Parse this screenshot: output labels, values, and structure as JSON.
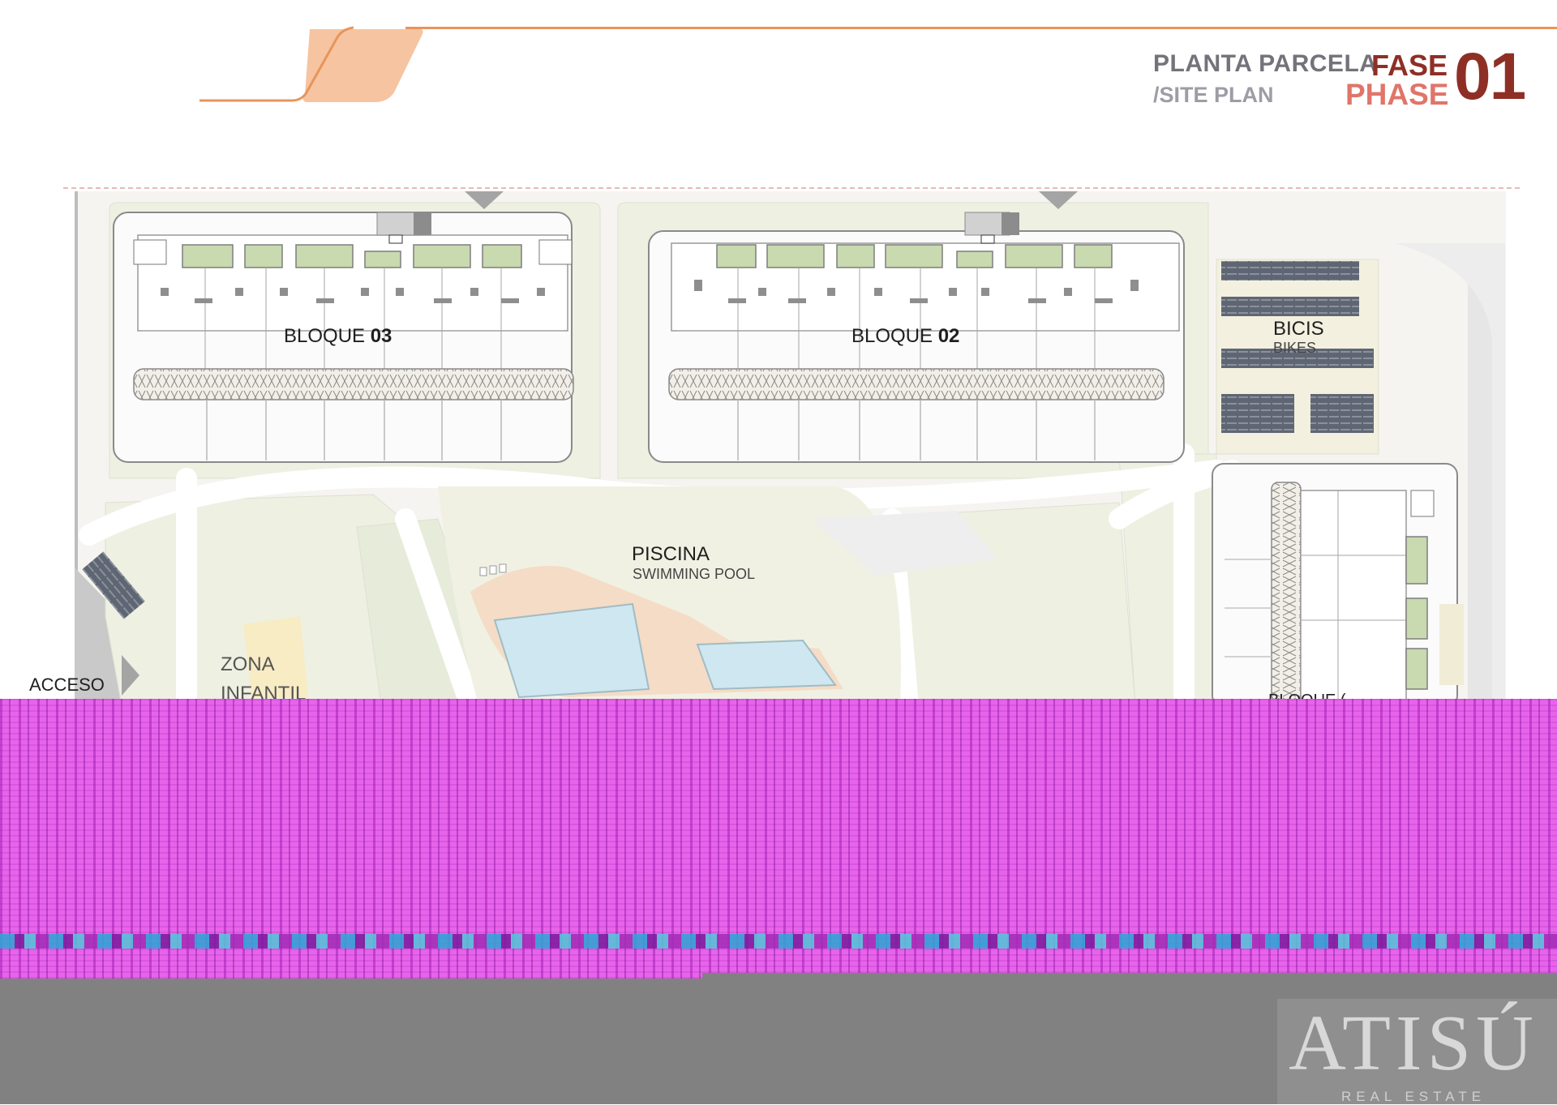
{
  "header": {
    "title_es": "PLANTA PARCELA",
    "title_en": "/SITE PLAN",
    "fase": "FASE",
    "phase": "PHASE",
    "number": "01"
  },
  "plan": {
    "block_prefix": "BLOQUE",
    "block_03_num": "03",
    "block_02_num": "02",
    "block_partial": "BLOQUE (",
    "bikes_es": "BICIS",
    "bikes_en": "BIKES",
    "pool_es": "PISCINA",
    "pool_en": "SWIMMING POOL",
    "access": "ACCESO",
    "kids_line1": "ZONA",
    "kids_line2": "INFANTIL"
  },
  "logo": {
    "name": "ATISÚ",
    "tagline": "REAL ESTATE"
  },
  "colors": {
    "accent_orange": "#e8955a",
    "phase_dark_red": "#8e2f26",
    "phase_light_red": "#e0756a",
    "garden_green": "#eef0e2",
    "pool_water": "#cfe7f0",
    "glitch_magenta": "#e764ea",
    "footer_gray": "#818181"
  }
}
